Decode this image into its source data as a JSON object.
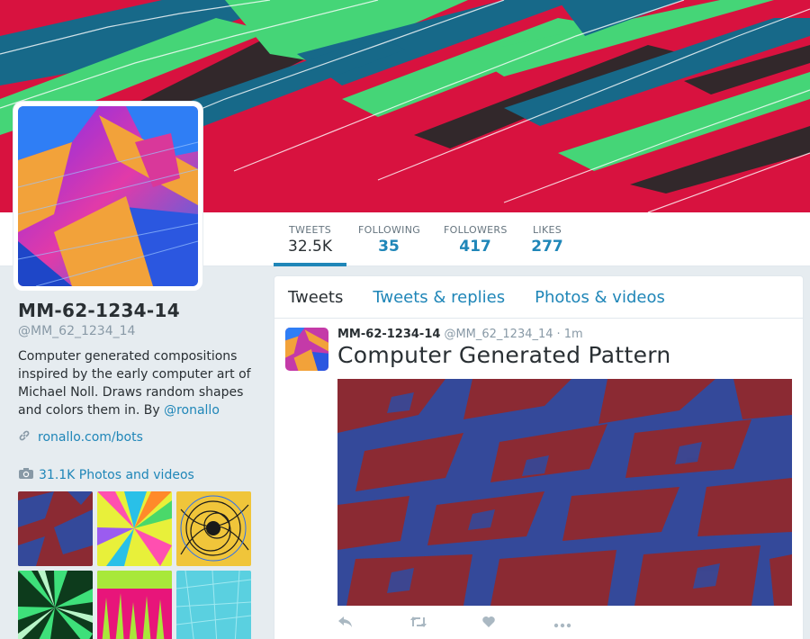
{
  "profile": {
    "name": "MM-62-1234-14",
    "handle": "@MM_62_1234_14",
    "bio_text": "Computer generated compositions inspired by the early computer art of Michael Noll. Draws random shapes and colors them in. By ",
    "bio_mention": "@ronallo",
    "website": "ronallo.com/bots",
    "photos_label": "31.1K Photos and videos"
  },
  "stats": [
    {
      "label": "TWEETS",
      "value": "32.5K"
    },
    {
      "label": "FOLLOWING",
      "value": "35"
    },
    {
      "label": "FOLLOWERS",
      "value": "417"
    },
    {
      "label": "LIKES",
      "value": "277"
    }
  ],
  "tabs": [
    "Tweets",
    "Tweets & replies",
    "Photos & videos"
  ],
  "tweet": {
    "name": "MM-62-1234-14",
    "handle": "@MM_62_1234_14",
    "separator": "·",
    "time": "1m",
    "text": "Computer Generated Pattern"
  },
  "icons": {
    "link": "link-icon",
    "camera": "camera-icon",
    "reply": "reply-icon",
    "retweet": "retweet-icon",
    "like": "heart-icon",
    "more": "more-icon"
  },
  "colors": {
    "accent": "#1f86b8",
    "banner_red": "#d8123f",
    "pattern_red": "#8b2a33",
    "pattern_blue": "#34499a"
  }
}
